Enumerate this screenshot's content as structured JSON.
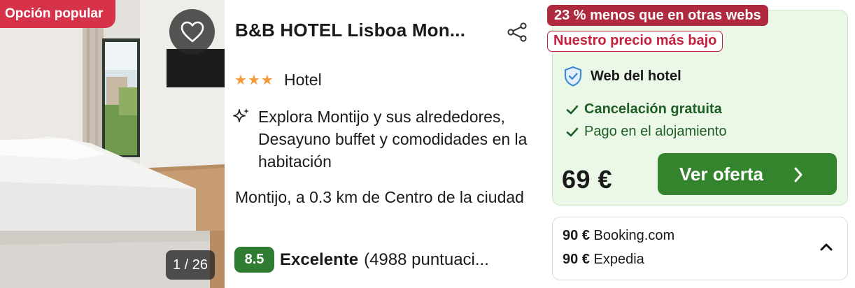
{
  "photo": {
    "badge": "Opción popular",
    "counter": "1 / 26"
  },
  "hotel": {
    "name": "B&B HOTEL Lisboa Mon...",
    "stars": 3,
    "type": "Hotel",
    "amenities": "Explora Montijo y sus alrededores, Desayuno buffet y comodidades en la habitación",
    "location": "Montijo, a 0.3 km de Centro de la ciudad",
    "score": "8.5",
    "rating_word": "Excelente",
    "reviews": "(4988 puntuaci..."
  },
  "deal": {
    "discount_badge": "23 % menos que en otras webs",
    "lowest_badge": "Nuestro precio más bajo",
    "site": "Web del hotel",
    "feature_1": "Cancelación gratuita",
    "feature_2": "Pago en el alojamiento",
    "price": "69 €",
    "cta_label": "Ver oferta"
  },
  "other_offers": [
    {
      "price": "90 €",
      "site": "Booking.com"
    },
    {
      "price": "90 €",
      "site": "Expedia"
    }
  ],
  "colors": {
    "popular_badge": "#d6334b",
    "discount_badge": "#b02a3f",
    "score_green": "#2e7d32",
    "cta_green": "#34842d",
    "deal_bg": "#ebf8e8",
    "star_orange": "#f29a3b"
  },
  "icons": [
    "heart-icon",
    "share-icon",
    "star-icon",
    "sparkle-icon",
    "shield-check-icon",
    "check-icon",
    "chevron-right-icon",
    "chevron-up-icon"
  ]
}
